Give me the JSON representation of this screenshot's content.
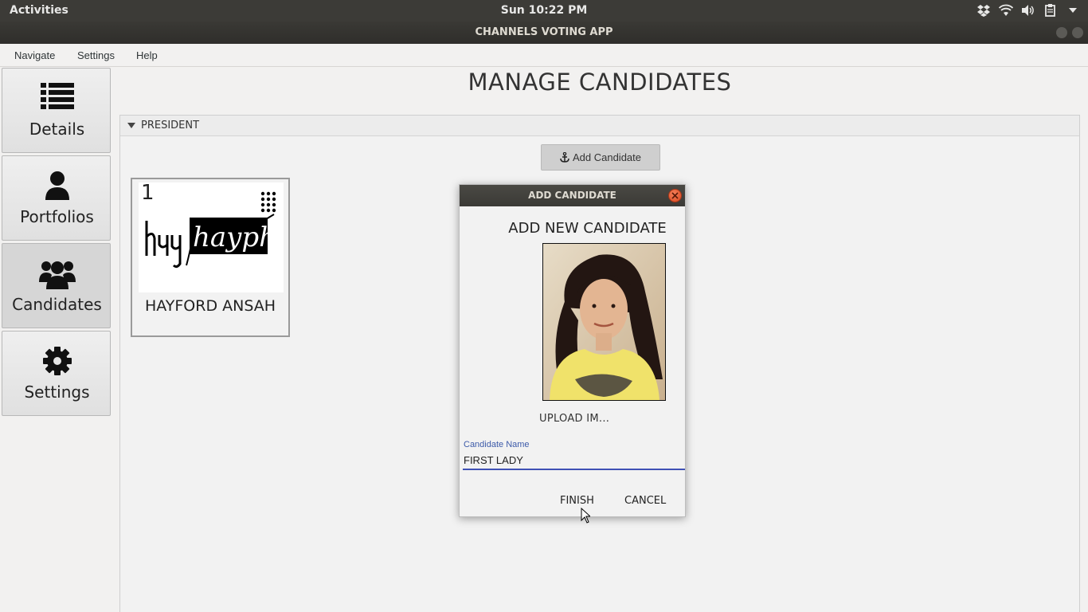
{
  "topbar": {
    "activities": "Activities",
    "clock": "Sun 10:22 PM"
  },
  "window": {
    "title": "CHANNELS VOTING APP"
  },
  "menu": {
    "navigate": "Navigate",
    "settings": "Settings",
    "help": "Help"
  },
  "sidebar": {
    "items": [
      {
        "label": "Details",
        "icon": "list-icon"
      },
      {
        "label": "Portfolios",
        "icon": "user-icon"
      },
      {
        "label": "Candidates",
        "icon": "users-icon",
        "active": true
      },
      {
        "label": "Settings",
        "icon": "gear-icon"
      }
    ]
  },
  "main": {
    "title": "MANAGE CANDIDATES",
    "section_title": "PRESIDENT",
    "add_button": "Add Candidate",
    "cards": [
      {
        "number": "1",
        "name": "HAYFORD ANSAH",
        "logo_text": "hayphord"
      }
    ]
  },
  "dialog": {
    "title": "ADD CANDIDATE",
    "heading": "ADD NEW CANDIDATE",
    "upload_label": "UPLOAD IM...",
    "field_label": "Candidate Name",
    "field_value": "FIRST LADY",
    "finish": "FINISH",
    "cancel": "CANCEL"
  },
  "colors": {
    "topbar": "#3c3b37",
    "accent": "#3f51b5",
    "close_button": "#e05a2b"
  }
}
